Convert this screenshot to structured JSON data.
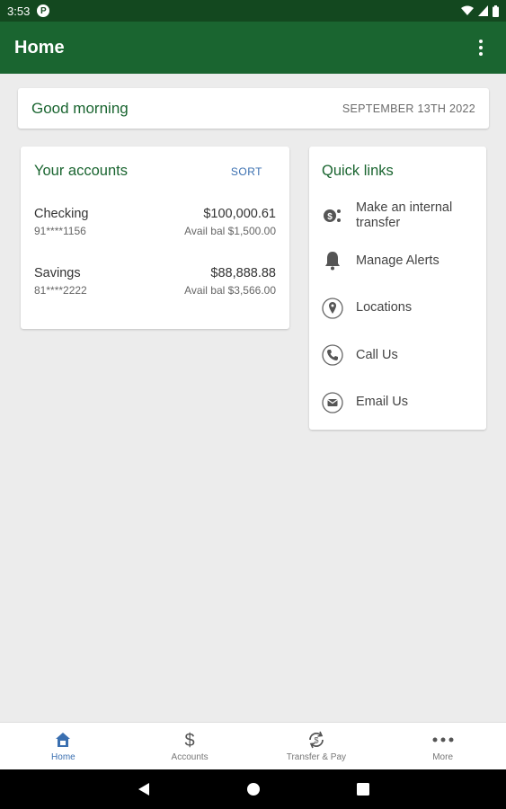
{
  "status_bar": {
    "time": "3:53",
    "notification_badge": "P"
  },
  "app_bar": {
    "title": "Home"
  },
  "greeting": {
    "text": "Good morning",
    "date": "SEPTEMBER 13TH 2022"
  },
  "accounts": {
    "title": "Your accounts",
    "sort_label": "SORT",
    "items": [
      {
        "name": "Checking",
        "number": "91****1156",
        "balance": "$100,000.61",
        "available": "Avail bal $1,500.00"
      },
      {
        "name": "Savings",
        "number": "81****2222",
        "balance": "$88,888.88",
        "available": "Avail bal $3,566.00"
      }
    ]
  },
  "quick_links": {
    "title": "Quick links",
    "items": [
      {
        "label": "Make an internal transfer",
        "icon": "transfer-icon"
      },
      {
        "label": "Manage Alerts",
        "icon": "bell-icon"
      },
      {
        "label": "Locations",
        "icon": "location-pin-icon"
      },
      {
        "label": "Call Us",
        "icon": "phone-icon"
      },
      {
        "label": "Email Us",
        "icon": "email-icon"
      }
    ]
  },
  "bottom_nav": {
    "items": [
      {
        "label": "Home",
        "icon": "home-icon",
        "active": true
      },
      {
        "label": "Accounts",
        "icon": "dollar-icon",
        "active": false
      },
      {
        "label": "Transfer & Pay",
        "icon": "transfer-pay-icon",
        "active": false
      },
      {
        "label": "More",
        "icon": "more-dots-icon",
        "active": false
      }
    ]
  },
  "colors": {
    "brand_dark": "#13481f",
    "brand": "#1a6530",
    "link": "#3a6fb0",
    "background": "#ececec"
  }
}
